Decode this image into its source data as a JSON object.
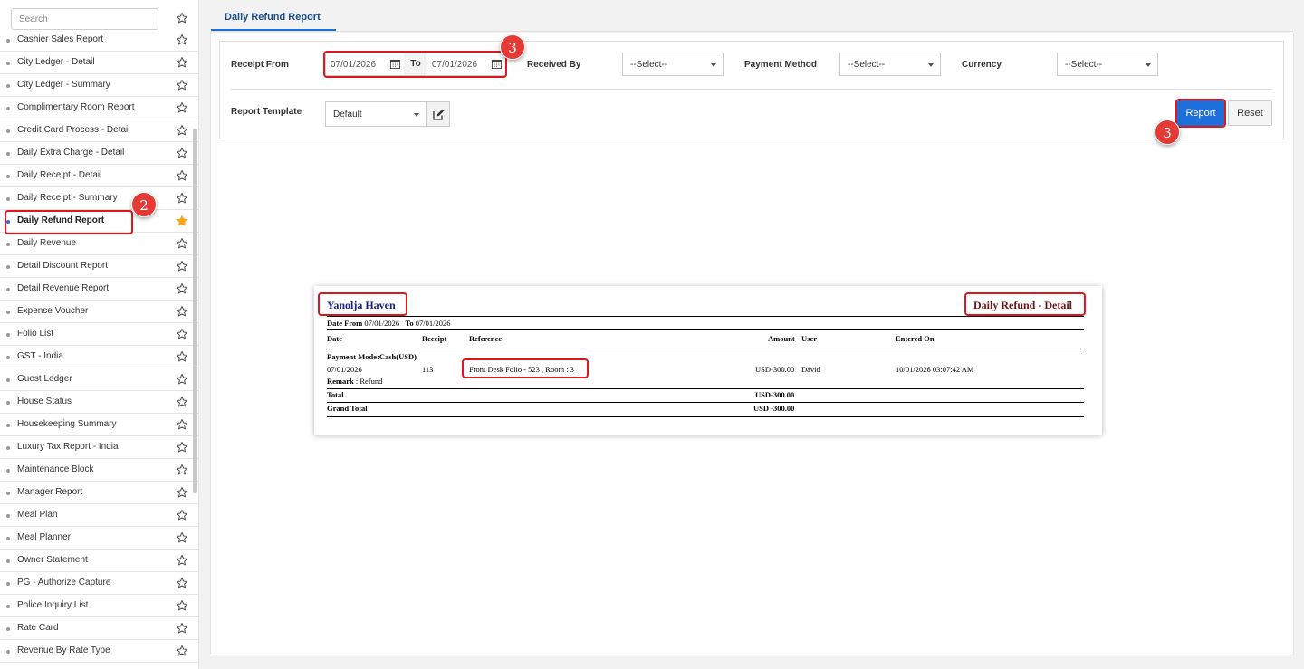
{
  "sidebar": {
    "search_placeholder": "Search",
    "items": [
      {
        "label": "Cashier Sales Report"
      },
      {
        "label": "City Ledger - Detail"
      },
      {
        "label": "City Ledger - Summary"
      },
      {
        "label": "Complimentary Room Report"
      },
      {
        "label": "Credit Card Process - Detail"
      },
      {
        "label": "Daily Extra Charge - Detail"
      },
      {
        "label": "Daily Receipt - Detail"
      },
      {
        "label": "Daily Receipt - Summary"
      },
      {
        "label": "Daily Refund Report"
      },
      {
        "label": "Daily Revenue"
      },
      {
        "label": "Detail Discount Report"
      },
      {
        "label": "Detail Revenue Report"
      },
      {
        "label": "Expense Voucher"
      },
      {
        "label": "Folio List"
      },
      {
        "label": "GST - India"
      },
      {
        "label": "Guest Ledger"
      },
      {
        "label": "House Status"
      },
      {
        "label": "Housekeeping Summary"
      },
      {
        "label": "Luxury Tax Report - India"
      },
      {
        "label": "Maintenance Block"
      },
      {
        "label": "Manager Report"
      },
      {
        "label": "Meal Plan"
      },
      {
        "label": "Meal Planner"
      },
      {
        "label": "Owner Statement"
      },
      {
        "label": "PG - Authorize Capture"
      },
      {
        "label": "Police Inquiry List"
      },
      {
        "label": "Rate Card"
      },
      {
        "label": "Revenue By Rate Type"
      }
    ],
    "active_index": 8
  },
  "tab": {
    "label": "Daily Refund Report"
  },
  "filters": {
    "receipt_from_label": "Receipt From",
    "date_from": "07/01/2026",
    "to_label": "To",
    "date_to": "07/01/2026",
    "received_by_label": "Received By",
    "received_by_value": "--Select--",
    "payment_method_label": "Payment Method",
    "payment_method_value": "--Select--",
    "currency_label": "Currency",
    "currency_value": "--Select--",
    "report_template_label": "Report Template",
    "report_template_value": "Default",
    "report_button": "Report",
    "reset_button": "Reset"
  },
  "annotations": {
    "badge_2": "2",
    "badge_3a": "3",
    "badge_3b": "3"
  },
  "report": {
    "hotel_name": "Yanolja Haven",
    "title": "Daily Refund - Detail",
    "date_from_label": "Date From",
    "date_from": "07/01/2026",
    "to_label": "To",
    "date_to": "07/01/2026",
    "columns": {
      "date": "Date",
      "receipt": "Receipt",
      "reference": "Reference",
      "amount": "Amount",
      "user": "User",
      "entered_on": "Entered On"
    },
    "payment_mode": "Payment Mode:Cash(USD)",
    "row": {
      "date": "07/01/2026",
      "receipt": "113",
      "reference": "Front Desk Folio - 523 , Room : 3",
      "amount": "USD-300.00",
      "user": "David",
      "entered_on": "10/01/2026 03:07:42 AM"
    },
    "remark_label": "Remark",
    "remark": ": Refund",
    "total_label": "Total",
    "total_value": "USD-300.00",
    "grand_total_label": "Grand Total",
    "grand_total_value": "USD -300.00"
  },
  "colors": {
    "accent": "#1e6fd9",
    "highlight": "#e0161c",
    "star_active": "#f5a623"
  }
}
